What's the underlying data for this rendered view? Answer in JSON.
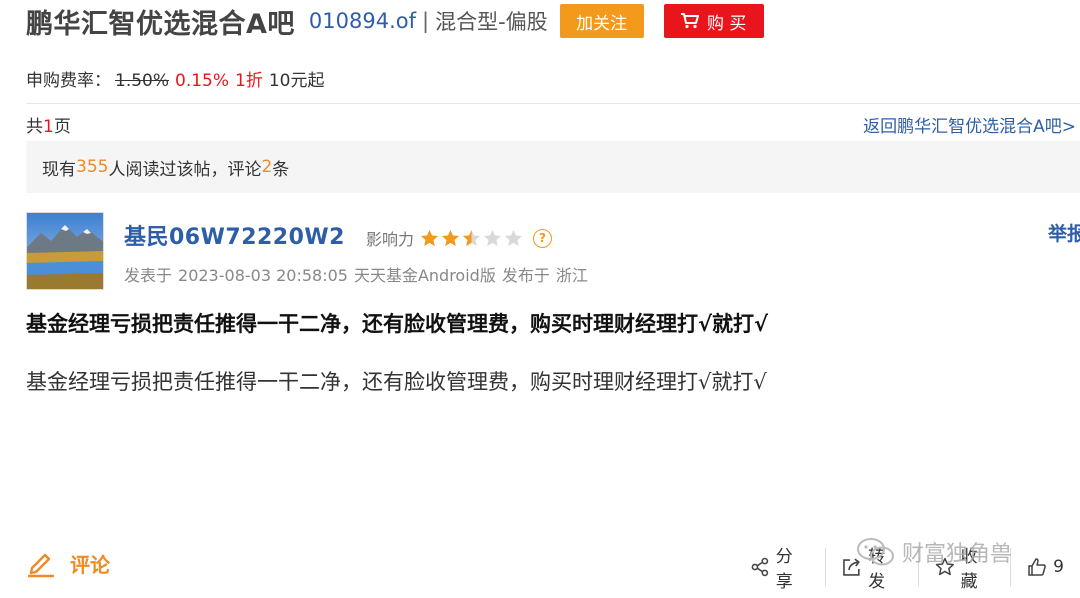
{
  "header": {
    "title": "鹏华汇智优选混合A吧",
    "code": "010894.of",
    "separator": "|",
    "fund_type": "混合型-偏股",
    "follow_label": "加关注",
    "buy_label": "购 买"
  },
  "fee": {
    "label": "申购费率：",
    "original_rate": "1.50%",
    "discount_rate": "0.15%",
    "discount_text": "1折",
    "min_amount": "10元起"
  },
  "pagination": {
    "prefix": "共",
    "count": "1",
    "suffix": "页",
    "back_link": "返回鹏华汇智优选混合A吧>"
  },
  "stats": {
    "prefix": "现有",
    "readers": "355",
    "middle": "人阅读过该帖，评论",
    "comments": "2",
    "suffix": "条"
  },
  "post": {
    "username": "基民06W72220W2",
    "influence_label": "影响力",
    "rating": 2.5,
    "rating_max": 5,
    "report_label": "举报",
    "posted_prefix": "发表于",
    "date": "2023-08-03 20:58:05",
    "source": "天天基金Android版",
    "location_prefix": "发布于",
    "location": "浙江",
    "title": "基金经理亏损把责任推得一干二净，还有脸收管理费，购买时理财经理打√就打√",
    "body": "基金经理亏损把责任推得一干二净，还有脸收管理费，购买时理财经理打√就打√"
  },
  "footer": {
    "comment_label": "评论",
    "share_label": "分享",
    "forward_label": "转发",
    "collect_label": "收藏",
    "like_count": "9"
  },
  "watermark": {
    "text": "财富独角兽"
  },
  "colors": {
    "link_blue": "#2e5ea8",
    "accent_red": "#e8161c",
    "accent_orange": "#f39a1c",
    "highlight_orange": "#f08a24"
  },
  "icons": [
    "cart-icon",
    "star-icon",
    "help-icon",
    "pencil-icon",
    "share-icon",
    "forward-icon",
    "collect-star-icon",
    "thumbs-up-icon",
    "wechat-icon"
  ]
}
